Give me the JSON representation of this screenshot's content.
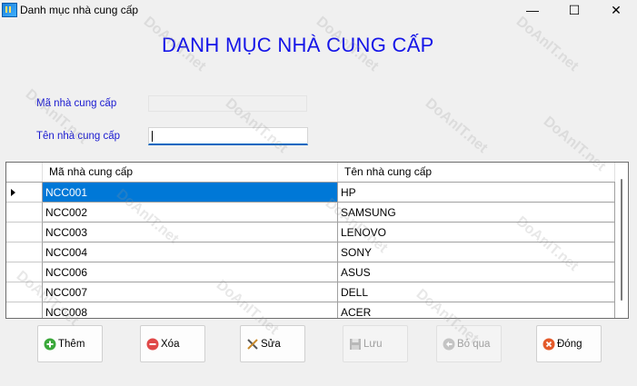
{
  "window": {
    "title": "Danh mục nhà cung cấp",
    "controls": {
      "minimize": "—",
      "maximize": "☐",
      "close": "✕"
    }
  },
  "heading": "DANH MỤC NHÀ CUNG CẤP",
  "form": {
    "code_label": "Mã nhà cung cấp",
    "code_value": "",
    "name_label": "Tên nhà cung cấp",
    "name_value": ""
  },
  "grid": {
    "columns": [
      "Mã nhà cung cấp",
      "Tên nhà cung cấp"
    ],
    "rows": [
      [
        "NCC001",
        "HP"
      ],
      [
        "NCC002",
        "SAMSUNG"
      ],
      [
        "NCC003",
        "LENOVO"
      ],
      [
        "NCC004",
        "SONY"
      ],
      [
        "NCC006",
        "ASUS"
      ],
      [
        "NCC007",
        "DELL"
      ],
      [
        "NCC008",
        "ACER"
      ]
    ],
    "selected_row": 0
  },
  "buttons": {
    "add": "Thêm",
    "delete": "Xóa",
    "edit": "Sửa",
    "save": "Lưu",
    "skip": "Bỏ qua",
    "close": "Đóng"
  },
  "watermark": "DoAnIT.net",
  "colors": {
    "heading": "#1515e8",
    "label": "#1a1ad0",
    "selection": "#0078d7"
  }
}
